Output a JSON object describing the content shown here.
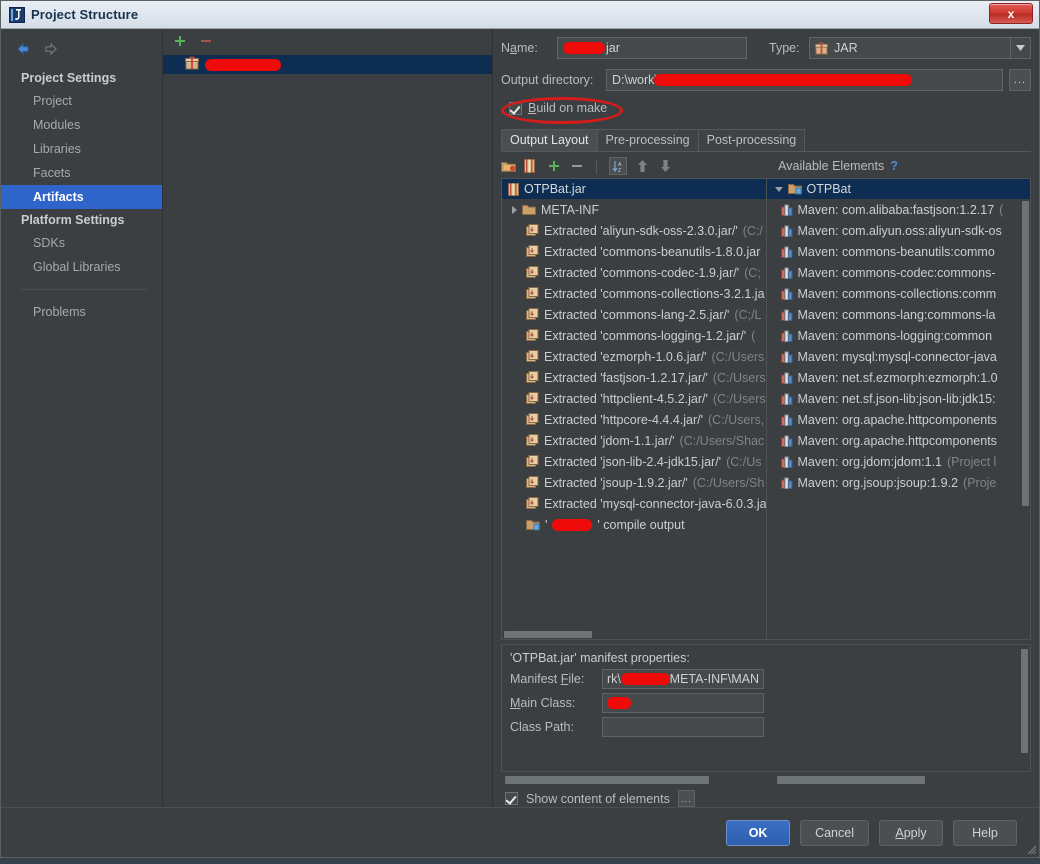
{
  "window": {
    "title": "Project Structure",
    "app_icon": "intellij-idea-icon",
    "close_label": "x"
  },
  "sidebar": {
    "back_icon": "back-arrow-icon",
    "forward_icon": "forward-arrow-icon",
    "groups": [
      {
        "label": "Project Settings",
        "items": [
          {
            "label": "Project",
            "selected": false
          },
          {
            "label": "Modules",
            "selected": false
          },
          {
            "label": "Libraries",
            "selected": false
          },
          {
            "label": "Facets",
            "selected": false
          },
          {
            "label": "Artifacts",
            "selected": true
          }
        ]
      },
      {
        "label": "Platform Settings",
        "items": [
          {
            "label": "SDKs",
            "selected": false
          },
          {
            "label": "Global Libraries",
            "selected": false
          }
        ]
      }
    ],
    "problems": "Problems"
  },
  "artifacts": {
    "toolbar": {
      "add_icon": "plus-icon",
      "remove_icon": "minus-icon"
    },
    "items": [
      {
        "icon": "jar-artifact-icon",
        "label": "",
        "redacted": true,
        "redact_width": 76,
        "selected": true
      }
    ]
  },
  "details": {
    "name_label": "Name:",
    "name_value": "jar",
    "name_redacted_width": 42,
    "type_label": "Type:",
    "type_value": "JAR",
    "type_icon": "jar-icon",
    "type_dropdown_icon": "chevron-down-icon",
    "output_dir_label": "Output directory:",
    "output_dir_value": "D:\\work\\",
    "output_dir_redact_width": 258,
    "browse_label": "...",
    "build_on_make_label": "Build on make",
    "build_on_make_checked": true,
    "annotation_circle_color": "#d81b1b",
    "tabs": [
      {
        "label": "Output Layout",
        "active": true
      },
      {
        "label": "Pre-processing",
        "active": false
      },
      {
        "label": "Post-processing",
        "active": false
      }
    ]
  },
  "elements_toolbar": {
    "buttons": [
      {
        "icon": "create-directory-icon",
        "name": "create-directory-button"
      },
      {
        "icon": "create-archive-icon",
        "name": "create-archive-button"
      },
      {
        "icon": "plus-icon",
        "name": "add-element-button"
      },
      {
        "icon": "minus-icon",
        "name": "remove-element-button"
      },
      {
        "icon": "sort-az-icon",
        "name": "sort-button"
      },
      {
        "icon": "arrow-up-icon",
        "name": "move-up-button"
      },
      {
        "icon": "arrow-down-icon",
        "name": "move-down-button"
      }
    ],
    "available_elements_label": "Available Elements",
    "help_label": "?"
  },
  "output_tree": {
    "root": {
      "icon": "archive-icon",
      "label": "OTPBat.jar"
    },
    "rows": [
      {
        "icon": "folder-icon",
        "label": "META-INF",
        "dim": "",
        "expander": "right",
        "indent": 1
      },
      {
        "icon": "extracted-icon",
        "label": "Extracted 'aliyun-sdk-oss-2.3.0.jar/'",
        "dim": "(C:/",
        "indent": 2
      },
      {
        "icon": "extracted-icon",
        "label": "Extracted 'commons-beanutils-1.8.0.jar",
        "dim": "",
        "indent": 2
      },
      {
        "icon": "extracted-icon",
        "label": "Extracted 'commons-codec-1.9.jar/'",
        "dim": "(C;",
        "indent": 2
      },
      {
        "icon": "extracted-icon",
        "label": "Extracted 'commons-collections-3.2.1.ja",
        "dim": "",
        "indent": 2
      },
      {
        "icon": "extracted-icon",
        "label": "Extracted 'commons-lang-2.5.jar/'",
        "dim": "(C;/L",
        "indent": 2
      },
      {
        "icon": "extracted-icon",
        "label": "Extracted 'commons-logging-1.2.jar/'",
        "dim": "(",
        "indent": 2
      },
      {
        "icon": "extracted-icon",
        "label": "Extracted 'ezmorph-1.0.6.jar/'",
        "dim": "(C:/Users",
        "indent": 2
      },
      {
        "icon": "extracted-icon",
        "label": "Extracted 'fastjson-1.2.17.jar/'",
        "dim": "(C:/Users",
        "indent": 2
      },
      {
        "icon": "extracted-icon",
        "label": "Extracted 'httpclient-4.5.2.jar/'",
        "dim": "(C:/Users",
        "indent": 2
      },
      {
        "icon": "extracted-icon",
        "label": "Extracted 'httpcore-4.4.4.jar/'",
        "dim": "(C:/Users,",
        "indent": 2
      },
      {
        "icon": "extracted-icon",
        "label": "Extracted 'jdom-1.1.jar/'",
        "dim": "(C:/Users/Shac",
        "indent": 2
      },
      {
        "icon": "extracted-icon",
        "label": "Extracted 'json-lib-2.4-jdk15.jar/'",
        "dim": "(C:/Us",
        "indent": 2
      },
      {
        "icon": "extracted-icon",
        "label": "Extracted 'jsoup-1.9.2.jar/'",
        "dim": "(C:/Users/Sh",
        "indent": 2
      },
      {
        "icon": "extracted-icon",
        "label": "Extracted 'mysql-connector-java-6.0.3.ja",
        "dim": "",
        "indent": 2
      },
      {
        "icon": "module-output-icon",
        "label": "' compile output",
        "dim": "",
        "indent": 2,
        "redacted": true,
        "redact_width": 40,
        "prefix": "'"
      }
    ]
  },
  "available_tree": {
    "root": {
      "icon": "module-icon",
      "label": "OTPBat",
      "expander": "down"
    },
    "rows": [
      {
        "icon": "maven-icon",
        "label": "Maven: com.alibaba:fastjson:1.2.17",
        "dim": "("
      },
      {
        "icon": "maven-icon",
        "label": "Maven: com.aliyun.oss:aliyun-sdk-os",
        "dim": ""
      },
      {
        "icon": "maven-icon",
        "label": "Maven: commons-beanutils:commo",
        "dim": ""
      },
      {
        "icon": "maven-icon",
        "label": "Maven: commons-codec:commons-",
        "dim": ""
      },
      {
        "icon": "maven-icon",
        "label": "Maven: commons-collections:comm",
        "dim": ""
      },
      {
        "icon": "maven-icon",
        "label": "Maven: commons-lang:commons-la",
        "dim": ""
      },
      {
        "icon": "maven-icon",
        "label": "Maven: commons-logging:common",
        "dim": ""
      },
      {
        "icon": "maven-icon",
        "label": "Maven: mysql:mysql-connector-java",
        "dim": ""
      },
      {
        "icon": "maven-icon",
        "label": "Maven: net.sf.ezmorph:ezmorph:1.0",
        "dim": ""
      },
      {
        "icon": "maven-icon",
        "label": "Maven: net.sf.json-lib:json-lib:jdk15:",
        "dim": ""
      },
      {
        "icon": "maven-icon",
        "label": "Maven: org.apache.httpcomponents",
        "dim": ""
      },
      {
        "icon": "maven-icon",
        "label": "Maven: org.apache.httpcomponents",
        "dim": ""
      },
      {
        "icon": "maven-icon",
        "label": "Maven: org.jdom:jdom:1.1",
        "dim": "(Project l"
      },
      {
        "icon": "maven-icon",
        "label": "Maven: org.jsoup:jsoup:1.9.2",
        "dim": "(Proje"
      }
    ]
  },
  "manifest": {
    "title": "'OTPBat.jar' manifest properties:",
    "manifest_file_label": "Manifest File:",
    "manifest_file_value_prefix": "rk\\",
    "manifest_file_value_suffix": "META-INF\\MAN",
    "manifest_file_redact_width": 50,
    "main_class_label": "Main Class:",
    "main_class_value": "",
    "main_class_redact_width": 24,
    "class_path_label": "Class Path:",
    "class_path_value": ""
  },
  "bottom": {
    "show_content_label": "Show content of elements",
    "show_content_checked": true,
    "more_label": "..."
  },
  "footer": {
    "buttons": [
      {
        "label": "OK",
        "primary": true,
        "name": "ok-button"
      },
      {
        "label": "Cancel",
        "primary": false,
        "name": "cancel-button"
      },
      {
        "label": "Apply",
        "primary": false,
        "name": "apply-button"
      },
      {
        "label": "Help",
        "primary": false,
        "name": "help-button"
      }
    ]
  },
  "colors": {
    "accent": "#2f65ca",
    "selection": "#0d2d52",
    "annotation": "#d81b1b",
    "background": "#3c3f41"
  }
}
